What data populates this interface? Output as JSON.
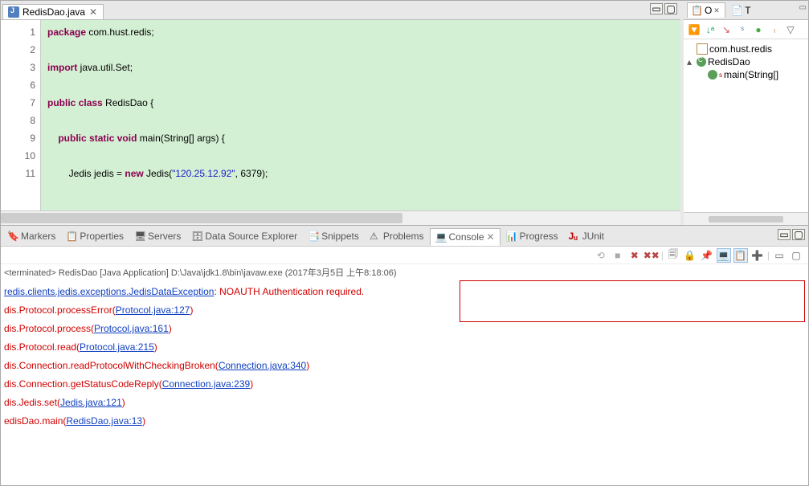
{
  "editor": {
    "tab_title": "RedisDao.java",
    "lines": [
      "1",
      "2",
      "3",
      "6",
      "7",
      "8",
      "9",
      "10",
      "11"
    ],
    "code_line1_kw": "package",
    "code_line1_rest": " com.hust.redis;",
    "code_line3_kw": "import",
    "code_line3_rest": " java.util.Set;",
    "code_line7a": "public",
    "code_line7b": "class",
    "code_line7c": " RedisDao {",
    "code_line9a": "public",
    "code_line9b": "static",
    "code_line9c": "void",
    "code_line9d": " main(String[] args) {",
    "code_line11a": "        Jedis jedis = ",
    "code_line11b": "new",
    "code_line11c": " Jedis(",
    "code_line11_str": "\"120.25.12.92\"",
    "code_line11d": ", 6379);"
  },
  "outline": {
    "tab1": "O",
    "tab2": "T",
    "node1": "com.hust.redis",
    "node2": "RedisDao",
    "node3": "main(String[]"
  },
  "views": {
    "markers": "Markers",
    "properties": "Properties",
    "servers": "Servers",
    "data_source": "Data Source Explorer",
    "snippets": "Snippets",
    "problems": "Problems",
    "console": "Console",
    "progress": "Progress",
    "junit": "JUnit"
  },
  "console": {
    "header": "<terminated> RedisDao [Java Application] D:\\Java\\jdk1.8\\bin\\javaw.exe (2017年3月5日 上午8:18:06)",
    "l1a": "redis.clients.jedis.exceptions.JedisDataException",
    "l1b": ": NOAUTH Authentication required.",
    "l2a": "dis.Protocol.processError(",
    "l2l": "Protocol.java:127",
    "l2b": ")",
    "l3a": "dis.Protocol.process(",
    "l3l": "Protocol.java:161",
    "l3b": ")",
    "l4a": "dis.Protocol.read(",
    "l4l": "Protocol.java:215",
    "l4b": ")",
    "l5a": "dis.Connection.readProtocolWithCheckingBroken(",
    "l5l": "Connection.java:340",
    "l5b": ")",
    "l6a": "dis.Connection.getStatusCodeReply(",
    "l6l": "Connection.java:239",
    "l6b": ")",
    "l7a": "dis.Jedis.set(",
    "l7l": "Jedis.java:121",
    "l7b": ")",
    "l8a": "edisDao.main(",
    "l8l": "RedisDao.java:13",
    "l8b": ")"
  }
}
